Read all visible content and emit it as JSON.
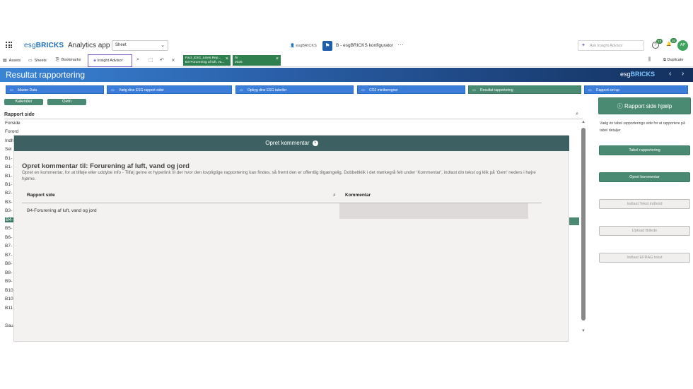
{
  "appbar": {
    "logo_prefix": "esg",
    "logo_bold": "BRICKS",
    "app_name": "Analytics app",
    "sheet_select": "Sheet",
    "user_label": "esgBRICKS",
    "publisher_title": "B - esgBRICKS konfigurator",
    "ask_placeholder": "Ask Insight Advisor",
    "notif_count_1": "13",
    "notif_count_2": "10",
    "avatar": "AP"
  },
  "toolbar": {
    "assets": "Assets",
    "sheets": "Sheets",
    "bookmarks": "Bookmarks",
    "insight": "Insight Advisor",
    "chip1_line1": "Fact_ESG_Lines.Rep...",
    "chip1_line2": "B4-Forurening af luft, va...",
    "chip2_line1": "År",
    "chip2_line2": "2025",
    "duplicate": "Duplicate"
  },
  "banner": {
    "title": "Resultat rapportering",
    "logo_prefix": "esg",
    "logo_bold": "BRICKS"
  },
  "nav": [
    {
      "label": "Master Data"
    },
    {
      "label": "Vælg dine ESG rapport sider"
    },
    {
      "label": "Opbyg dine ESG tabeller"
    },
    {
      "label": "CO2 miniberegner"
    },
    {
      "label": "Resultat rapportering"
    },
    {
      "label": "Rapport set-up"
    }
  ],
  "pills": {
    "kalender": "Kalender",
    "gem": "Gem"
  },
  "list": {
    "header": "Rapport side",
    "items": [
      "Forside",
      "Forord",
      "Indh",
      "Sel",
      "B1-",
      "B1-",
      "B1-",
      "B1-",
      "B2-",
      "B3-",
      "B3-",
      "B4-",
      "B5-",
      "B6-",
      "B7-",
      "B7-",
      "B8-",
      "B8-",
      "B9-",
      "B10",
      "B10",
      "B11",
      "Sau"
    ]
  },
  "right": {
    "help_button": "Rapport side hjælp",
    "help_text": "Vælg én tabel rapporterings side for at rapportere på tabel detaljer",
    "btn_tabel": "Tabel rapportering",
    "btn_kommentar": "Opret kommentar",
    "btn_tekst": "Indtast Tekst indhold",
    "btn_billede": "Upload Billede",
    "btn_efrag": "Indtast EFRAG tekst"
  },
  "modal": {
    "header": "Opret kommentar",
    "title": "Opret kommentar til: Forurening af luft, vand og jord",
    "description": "Opret en kommentar, for at tilføje eller uddybe info - Tilføj gerne et hyperlink til der hvor den lovpligtige rapportering kan findes, så fremt den er offentlig tilgængelig. Dobbeltklik i det mørkegrå felt under 'Kommentar', indtast din tekst og klik på 'Gem' neders i højre hjørne.",
    "col1": "Rapport side",
    "col2": "Kommentar",
    "row_label": "B4-Forurening af luft, vand og jord"
  }
}
